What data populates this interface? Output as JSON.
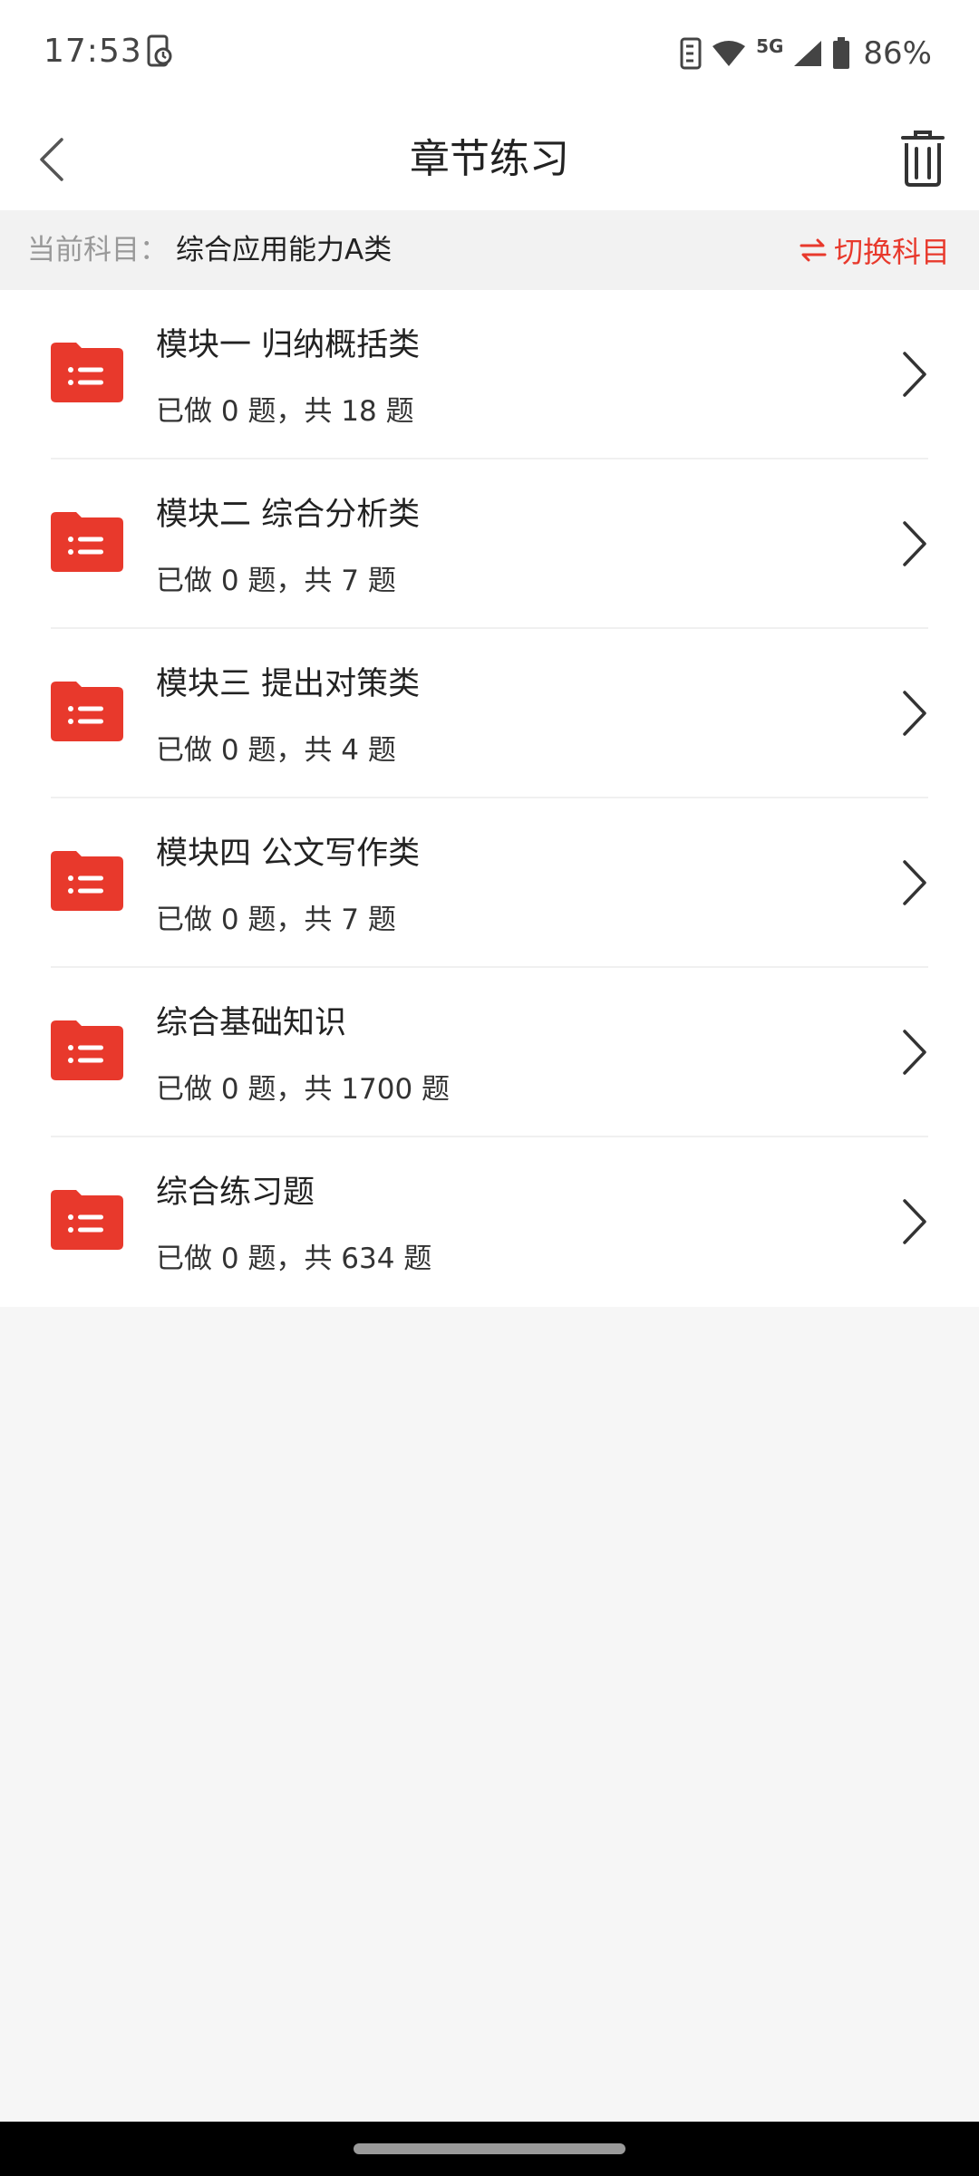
{
  "status_bar": {
    "time": "17:53",
    "network": "5G",
    "battery": "86%",
    "icons": [
      "screen-rotation-icon",
      "nfc-icon",
      "wifi-icon",
      "signal-icon",
      "battery-icon"
    ]
  },
  "nav": {
    "title": "章节练习",
    "icons": [
      "back-icon",
      "trash-icon"
    ]
  },
  "subject": {
    "label": "当前科目：",
    "value": "综合应用能力A类",
    "switch_label": "切换科目",
    "switch_icon": "swap-arrows-icon"
  },
  "chapters": [
    {
      "title": "模块一 归纳概括类",
      "progress": "已做 0 题，共 18 题"
    },
    {
      "title": "模块二 综合分析类",
      "progress": "已做 0 题，共 7 题"
    },
    {
      "title": "模块三 提出对策类",
      "progress": "已做 0 题，共 4 题"
    },
    {
      "title": "模块四 公文写作类",
      "progress": "已做 0 题，共 7 题"
    },
    {
      "title": "综合基础知识",
      "progress": "已做 0 题，共 1700 题"
    },
    {
      "title": "综合练习题",
      "progress": "已做 0 题，共 634 题"
    }
  ],
  "colors": {
    "accent": "#e8392c",
    "background": "#f6f6f6",
    "card": "#ffffff"
  }
}
